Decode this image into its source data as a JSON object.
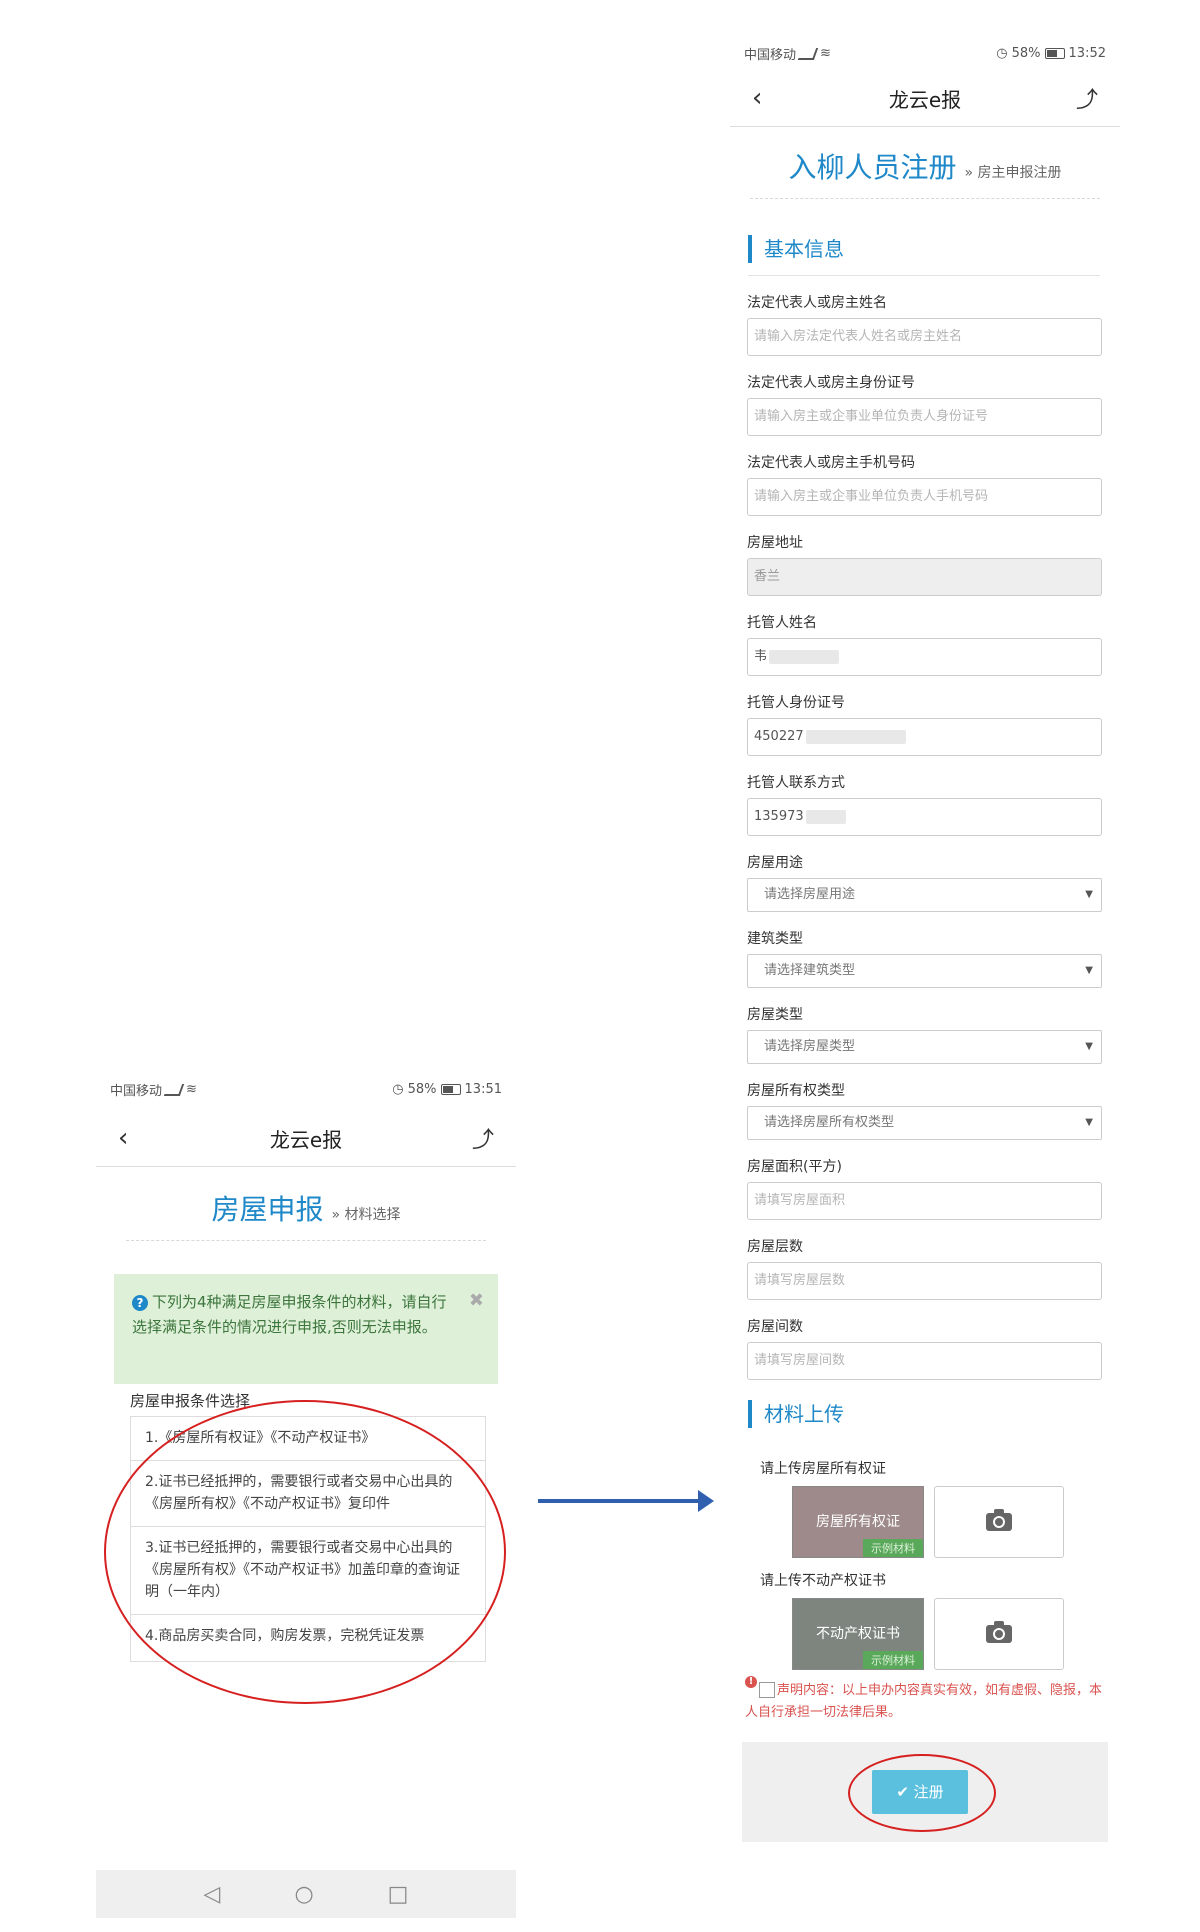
{
  "left": {
    "status": {
      "carrier": "中国移动",
      "battery": "58%",
      "time": "13:51"
    },
    "nav": {
      "title": "龙云e报"
    },
    "page_title": "房屋申报",
    "page_subtitle": "» 材料选择",
    "alert_text": "下列为4种满足房屋申报条件的材料，请自行选择满足条件的情况进行申报,否则无法申报。",
    "condition_label": "房屋申报条件选择",
    "conditions": [
      "1.《房屋所有权证》《不动产权证书》",
      "2.证书已经抵押的，需要银行或者交易中心出具的《房屋所有权》《不动产权证书》复印件",
      "3.证书已经抵押的，需要银行或者交易中心出具的《房屋所有权》《不动产权证书》加盖印章的查询证明（一年内）",
      "4.商品房买卖合同，购房发票，完税凭证发票"
    ]
  },
  "right": {
    "status": {
      "carrier": "中国移动",
      "battery": "58%",
      "time": "13:52"
    },
    "nav": {
      "title": "龙云e报"
    },
    "page_title": "入柳人员注册",
    "page_subtitle": "» 房主申报注册",
    "section_basic": "基本信息",
    "fields": [
      {
        "label": "法定代表人或房主姓名",
        "placeholder": "请输入房法定代表人姓名或房主姓名",
        "value": ""
      },
      {
        "label": "法定代表人或房主身份证号",
        "placeholder": "请输入房主或企事业单位负责人身份证号",
        "value": ""
      },
      {
        "label": "法定代表人或房主手机号码",
        "placeholder": "请输入房主或企事业单位负责人手机号码",
        "value": ""
      },
      {
        "label": "房屋地址",
        "placeholder": "",
        "value": "香兰"
      },
      {
        "label": "托管人姓名",
        "placeholder": "",
        "value": "韦"
      },
      {
        "label": "托管人身份证号",
        "placeholder": "",
        "value": "450227"
      },
      {
        "label": "托管人联系方式",
        "placeholder": "",
        "value": "135973"
      }
    ],
    "selects": [
      {
        "label": "房屋用途",
        "value": "请选择房屋用途"
      },
      {
        "label": "建筑类型",
        "value": "请选择建筑类型"
      },
      {
        "label": "房屋类型",
        "value": "请选择房屋类型"
      },
      {
        "label": "房屋所有权类型",
        "value": "请选择房屋所有权类型"
      }
    ],
    "fields2": [
      {
        "label": "房屋面积(平方)",
        "placeholder": "请填写房屋面积"
      },
      {
        "label": "房屋层数",
        "placeholder": "请填写房屋层数"
      },
      {
        "label": "房屋间数",
        "placeholder": "请填写房屋间数"
      }
    ],
    "section_upload": "材料上传",
    "uploads": [
      {
        "label": "请上传房屋所有权证",
        "sample_text": "房屋所有权证",
        "sample_tag": "示例材料"
      },
      {
        "label": "请上传不动产权证书",
        "sample_text": "不动产权证书",
        "sample_tag": "示例材料"
      }
    ],
    "declaration": "声明内容：以上申办内容真实有效，如有虚假、隐报，本人自行承担一切法律后果。",
    "register_label": "✔ 注册"
  }
}
